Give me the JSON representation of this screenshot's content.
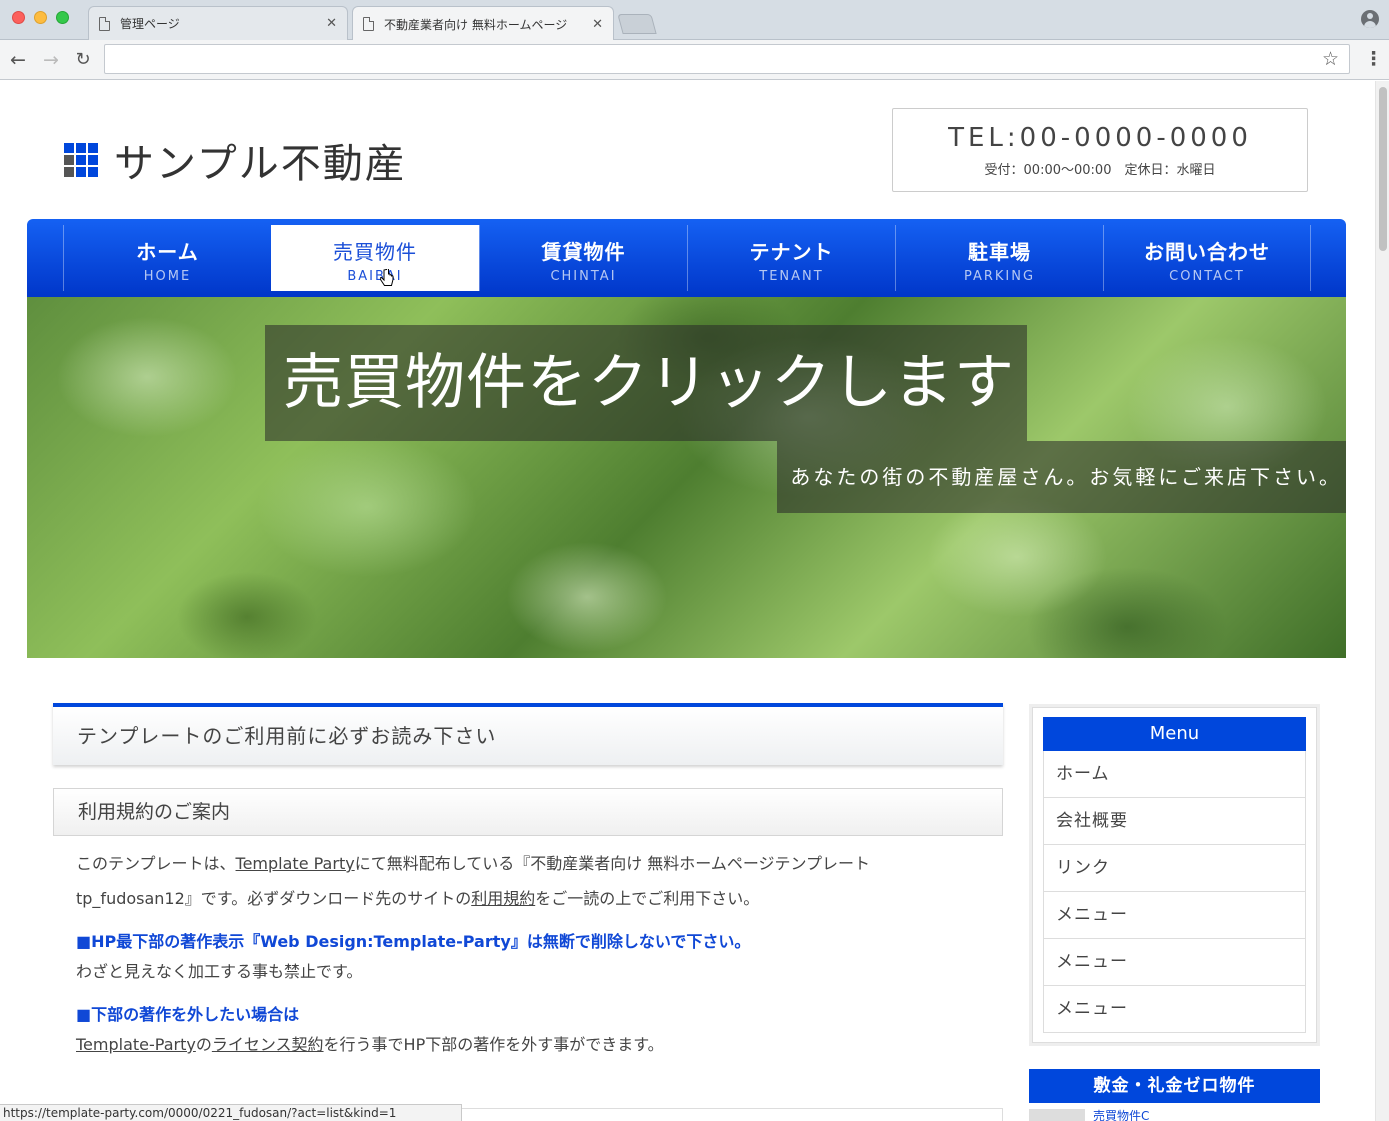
{
  "browser": {
    "tabs": [
      {
        "title": "管理ページ"
      },
      {
        "title": "不動産業者向け 無料ホームページ"
      }
    ],
    "url": "",
    "status_url": "https://template-party.com/0000/0221_fudosan/?act=list&kind=1"
  },
  "header": {
    "site_title": "サンプル不動産",
    "tel": "TEL:00-0000-0000",
    "hours": "受付：00:00〜00:00　定休日：水曜日"
  },
  "nav": {
    "items": [
      {
        "jp": "ホーム",
        "en": "HOME"
      },
      {
        "jp": "売買物件",
        "en": "BAIBAI"
      },
      {
        "jp": "賃貸物件",
        "en": "CHINTAI"
      },
      {
        "jp": "テナント",
        "en": "TENANT"
      },
      {
        "jp": "駐車場",
        "en": "PARKING"
      },
      {
        "jp": "お問い合わせ",
        "en": "CONTACT"
      }
    ],
    "active_index": 1
  },
  "hero": {
    "title": "売買物件をクリックします",
    "subtitle": "あなたの街の不動産屋さん。お気軽にご来店下さい。"
  },
  "main": {
    "h2": "テンプレートのご利用前に必ずお読み下さい",
    "h3": "利用規約のご案内",
    "p1": {
      "a": "このテンプレートは、",
      "link1": "Template Party",
      "b": "にて無料配布している『不動産業者向け 無料ホームページテンプレート",
      "c": "tp_fudosan12』です。必ずダウンロード先のサイトの",
      "link2": "利用規約",
      "d": "をご一読の上でご利用下さい。"
    },
    "notice1_head": "■HP最下部の著作表示『Web Design:Template-Party』は無断で削除しないで下さい。",
    "notice1_body": "わざと見えなく加工する事も禁止です。",
    "notice2_head": "■下部の著作を外したい場合は",
    "notice2_body": {
      "link1": "Template-Party",
      "a": "の",
      "link2": "ライセンス契約",
      "b": "を行う事でHP下部の著作を外す事ができます。"
    }
  },
  "sidebar": {
    "menu_title": "Menu",
    "menu_items": [
      "ホーム",
      "会社概要",
      "リンク",
      "メニュー",
      "メニュー",
      "メニュー"
    ],
    "box2_title": "敷金・礼金ゼロ物件",
    "box2_first_link": "売買物件C"
  },
  "colors": {
    "accent": "#0047dc",
    "text": "#333333"
  }
}
